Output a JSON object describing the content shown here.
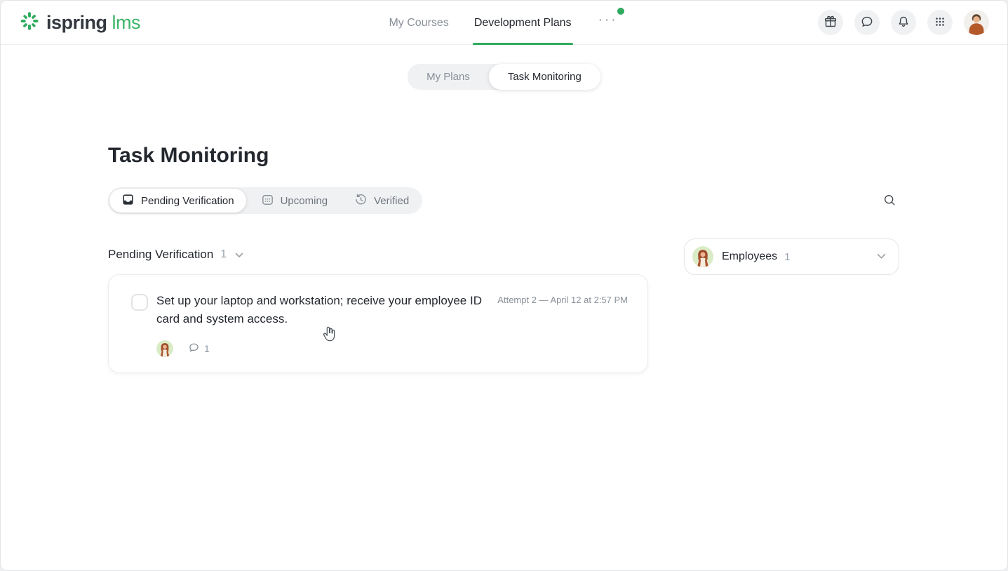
{
  "colors": {
    "accent_green": "#2fab5f",
    "text_dark": "#23272e",
    "text_muted": "#8a9099",
    "chip_bg": "#f0f1f3"
  },
  "header": {
    "logo_primary": "ispring",
    "logo_secondary": "lms",
    "nav": [
      {
        "label": "My Courses",
        "active": false
      },
      {
        "label": "Development Plans",
        "active": true
      }
    ],
    "more_label": "···"
  },
  "view_switcher": {
    "tabs": [
      {
        "label": "My Plans",
        "active": false
      },
      {
        "label": "Task Monitoring",
        "active": true
      }
    ]
  },
  "page": {
    "title": "Task Monitoring"
  },
  "filters": {
    "tabs": [
      {
        "label": "Pending Verification",
        "icon": "inbox-icon",
        "active": true
      },
      {
        "label": "Upcoming",
        "icon": "calendar-icon",
        "active": false
      },
      {
        "label": "Verified",
        "icon": "history-icon",
        "active": false
      }
    ]
  },
  "section": {
    "title": "Pending Verification",
    "count": "1"
  },
  "tasks": [
    {
      "text": "Set up your laptop and workstation; receive your employee ID card and system access.",
      "attempt_info": "Attempt 2 — April 12 at 2:57 PM",
      "comments": "1"
    }
  ],
  "employees_panel": {
    "label": "Employees",
    "count": "1"
  }
}
